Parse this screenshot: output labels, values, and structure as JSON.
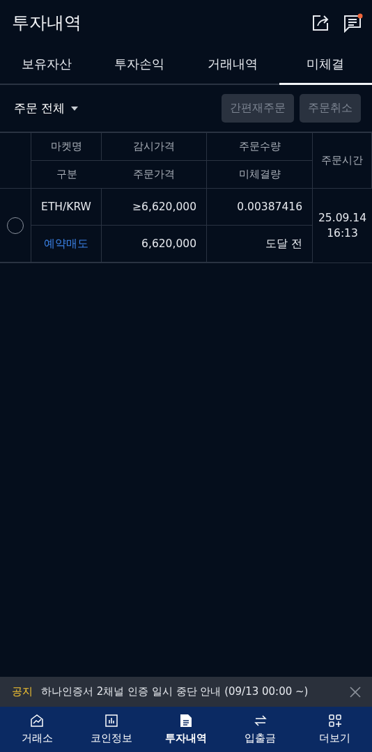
{
  "header": {
    "title": "투자내역",
    "notification_badge": true
  },
  "tabs": [
    {
      "label": "보유자산",
      "selected": false
    },
    {
      "label": "투자손익",
      "selected": false
    },
    {
      "label": "거래내역",
      "selected": false
    },
    {
      "label": "미체결",
      "selected": true
    }
  ],
  "filter": {
    "label": "주문 전체"
  },
  "buttons": [
    {
      "label": "간편재주문",
      "disabled": true
    },
    {
      "label": "주문취소",
      "disabled": true
    }
  ],
  "table": {
    "columns_top": [
      "마켓명",
      "감시가격",
      "주문수량"
    ],
    "columns_bottom": [
      "구분",
      "주문가격",
      "미체결량"
    ],
    "time_column": "주문시간",
    "rows": [
      {
        "selected": false,
        "market": "ETH/KRW",
        "watch_price": "≥6,620,000",
        "quantity": "0.00387416",
        "type": "예약매도",
        "color": "#3b82e6",
        "order_price": "6,620,000",
        "unfilled": "도달 전",
        "date": "25.09.14",
        "time": "16:13"
      }
    ]
  },
  "notice": {
    "label": "공지",
    "text": "하나인증서 2채널 인증 일시 중단 안내 (09/13 00:00 ~)"
  },
  "bottom_nav": [
    {
      "label": "거래소",
      "kind": "exchange",
      "selected": false
    },
    {
      "label": "코인정보",
      "kind": "chart",
      "selected": false
    },
    {
      "label": "투자내역",
      "kind": "doc",
      "selected": true
    },
    {
      "label": "입출금",
      "kind": "transfer",
      "selected": false
    },
    {
      "label": "더보기",
      "kind": "more",
      "selected": false
    }
  ]
}
